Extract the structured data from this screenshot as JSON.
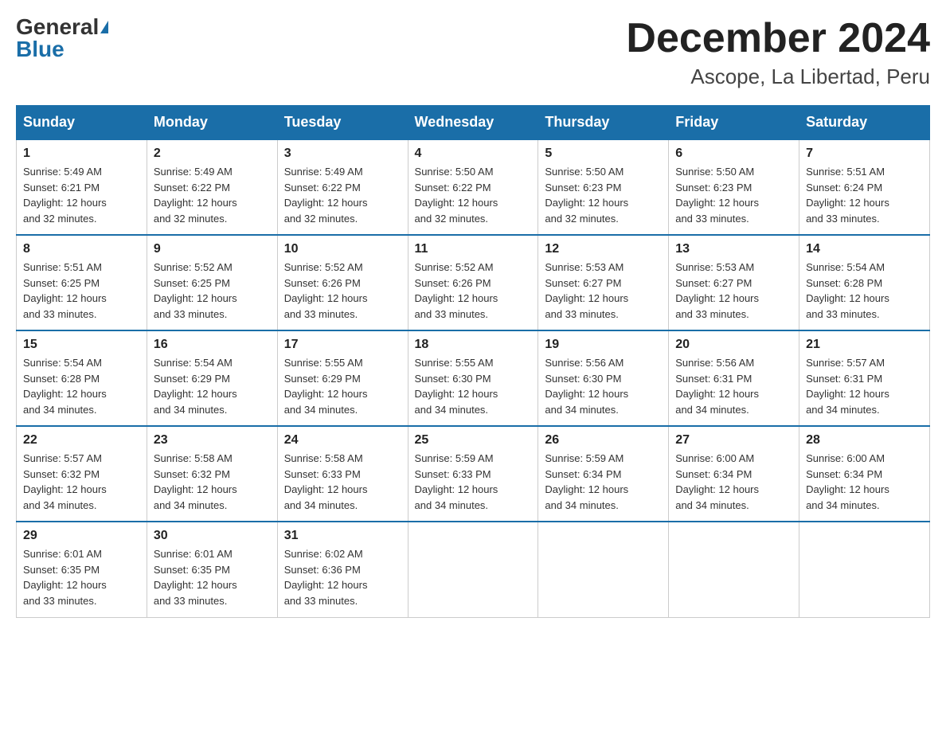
{
  "header": {
    "logo_general": "General",
    "logo_blue": "Blue",
    "month_title": "December 2024",
    "location": "Ascope, La Libertad, Peru"
  },
  "days_of_week": [
    "Sunday",
    "Monday",
    "Tuesday",
    "Wednesday",
    "Thursday",
    "Friday",
    "Saturday"
  ],
  "weeks": [
    [
      {
        "day": "1",
        "sunrise": "5:49 AM",
        "sunset": "6:21 PM",
        "daylight": "12 hours and 32 minutes."
      },
      {
        "day": "2",
        "sunrise": "5:49 AM",
        "sunset": "6:22 PM",
        "daylight": "12 hours and 32 minutes."
      },
      {
        "day": "3",
        "sunrise": "5:49 AM",
        "sunset": "6:22 PM",
        "daylight": "12 hours and 32 minutes."
      },
      {
        "day": "4",
        "sunrise": "5:50 AM",
        "sunset": "6:22 PM",
        "daylight": "12 hours and 32 minutes."
      },
      {
        "day": "5",
        "sunrise": "5:50 AM",
        "sunset": "6:23 PM",
        "daylight": "12 hours and 32 minutes."
      },
      {
        "day": "6",
        "sunrise": "5:50 AM",
        "sunset": "6:23 PM",
        "daylight": "12 hours and 33 minutes."
      },
      {
        "day": "7",
        "sunrise": "5:51 AM",
        "sunset": "6:24 PM",
        "daylight": "12 hours and 33 minutes."
      }
    ],
    [
      {
        "day": "8",
        "sunrise": "5:51 AM",
        "sunset": "6:25 PM",
        "daylight": "12 hours and 33 minutes."
      },
      {
        "day": "9",
        "sunrise": "5:52 AM",
        "sunset": "6:25 PM",
        "daylight": "12 hours and 33 minutes."
      },
      {
        "day": "10",
        "sunrise": "5:52 AM",
        "sunset": "6:26 PM",
        "daylight": "12 hours and 33 minutes."
      },
      {
        "day": "11",
        "sunrise": "5:52 AM",
        "sunset": "6:26 PM",
        "daylight": "12 hours and 33 minutes."
      },
      {
        "day": "12",
        "sunrise": "5:53 AM",
        "sunset": "6:27 PM",
        "daylight": "12 hours and 33 minutes."
      },
      {
        "day": "13",
        "sunrise": "5:53 AM",
        "sunset": "6:27 PM",
        "daylight": "12 hours and 33 minutes."
      },
      {
        "day": "14",
        "sunrise": "5:54 AM",
        "sunset": "6:28 PM",
        "daylight": "12 hours and 33 minutes."
      }
    ],
    [
      {
        "day": "15",
        "sunrise": "5:54 AM",
        "sunset": "6:28 PM",
        "daylight": "12 hours and 34 minutes."
      },
      {
        "day": "16",
        "sunrise": "5:54 AM",
        "sunset": "6:29 PM",
        "daylight": "12 hours and 34 minutes."
      },
      {
        "day": "17",
        "sunrise": "5:55 AM",
        "sunset": "6:29 PM",
        "daylight": "12 hours and 34 minutes."
      },
      {
        "day": "18",
        "sunrise": "5:55 AM",
        "sunset": "6:30 PM",
        "daylight": "12 hours and 34 minutes."
      },
      {
        "day": "19",
        "sunrise": "5:56 AM",
        "sunset": "6:30 PM",
        "daylight": "12 hours and 34 minutes."
      },
      {
        "day": "20",
        "sunrise": "5:56 AM",
        "sunset": "6:31 PM",
        "daylight": "12 hours and 34 minutes."
      },
      {
        "day": "21",
        "sunrise": "5:57 AM",
        "sunset": "6:31 PM",
        "daylight": "12 hours and 34 minutes."
      }
    ],
    [
      {
        "day": "22",
        "sunrise": "5:57 AM",
        "sunset": "6:32 PM",
        "daylight": "12 hours and 34 minutes."
      },
      {
        "day": "23",
        "sunrise": "5:58 AM",
        "sunset": "6:32 PM",
        "daylight": "12 hours and 34 minutes."
      },
      {
        "day": "24",
        "sunrise": "5:58 AM",
        "sunset": "6:33 PM",
        "daylight": "12 hours and 34 minutes."
      },
      {
        "day": "25",
        "sunrise": "5:59 AM",
        "sunset": "6:33 PM",
        "daylight": "12 hours and 34 minutes."
      },
      {
        "day": "26",
        "sunrise": "5:59 AM",
        "sunset": "6:34 PM",
        "daylight": "12 hours and 34 minutes."
      },
      {
        "day": "27",
        "sunrise": "6:00 AM",
        "sunset": "6:34 PM",
        "daylight": "12 hours and 34 minutes."
      },
      {
        "day": "28",
        "sunrise": "6:00 AM",
        "sunset": "6:34 PM",
        "daylight": "12 hours and 34 minutes."
      }
    ],
    [
      {
        "day": "29",
        "sunrise": "6:01 AM",
        "sunset": "6:35 PM",
        "daylight": "12 hours and 33 minutes."
      },
      {
        "day": "30",
        "sunrise": "6:01 AM",
        "sunset": "6:35 PM",
        "daylight": "12 hours and 33 minutes."
      },
      {
        "day": "31",
        "sunrise": "6:02 AM",
        "sunset": "6:36 PM",
        "daylight": "12 hours and 33 minutes."
      },
      null,
      null,
      null,
      null
    ]
  ],
  "labels": {
    "sunrise": "Sunrise:",
    "sunset": "Sunset:",
    "daylight": "Daylight:"
  }
}
